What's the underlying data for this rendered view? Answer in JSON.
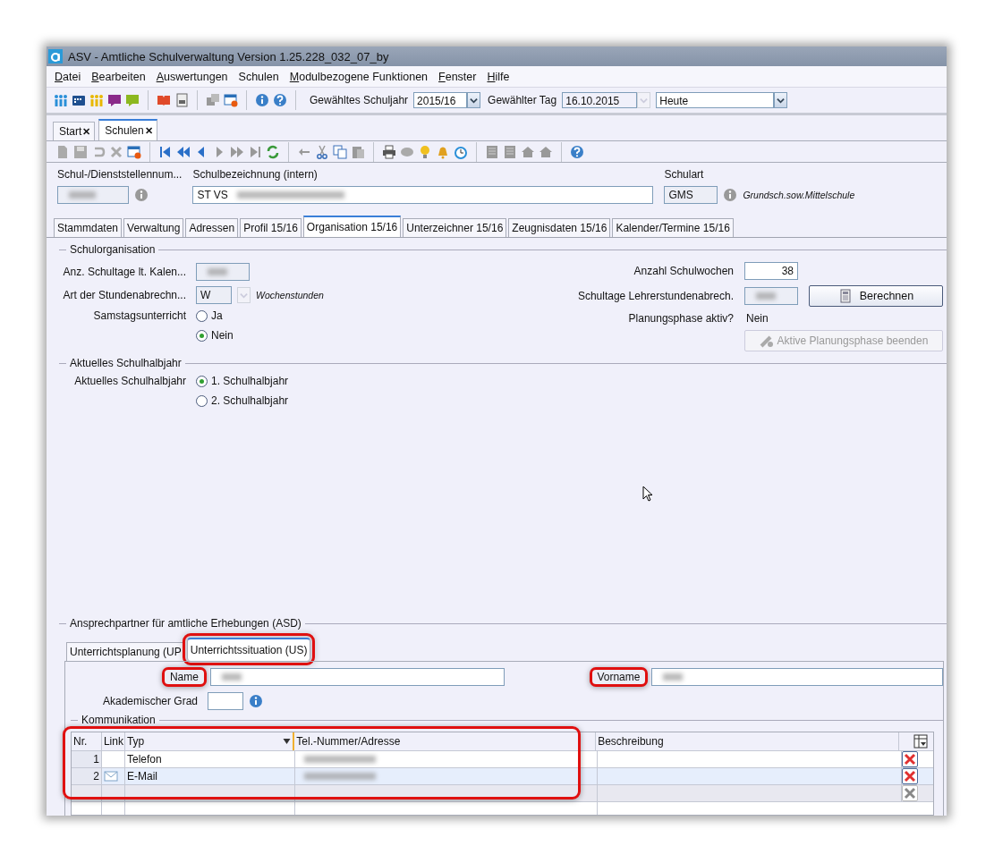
{
  "window": {
    "title": "ASV - Amtliche Schulverwaltung Version 1.25.228_032_07_by"
  },
  "menu": [
    {
      "label": "Datei",
      "mnemonic": true
    },
    {
      "label": "Bearbeiten",
      "mnemonic": true
    },
    {
      "label": "Auswertungen",
      "mnemonic": true
    },
    {
      "label": "Schulen",
      "mnemonic": false
    },
    {
      "label": "Modulbezogene Funktionen",
      "mnemonic": true
    },
    {
      "label": "Fenster",
      "mnemonic": true
    },
    {
      "label": "Hilfe",
      "mnemonic": true
    }
  ],
  "toolbar": {
    "schuljahr_label": "Gewähltes Schuljahr",
    "schuljahr": "2015/16",
    "tag_label": "Gewählter Tag",
    "tag": "16.10.2015",
    "tag_dropdown_disabled": true,
    "tag_mode": "Heute"
  },
  "document_tabs": [
    {
      "label": "Start",
      "close": "✕",
      "selected": false
    },
    {
      "label": "Schulen",
      "close": "✕",
      "selected": true
    }
  ],
  "header": {
    "nummer_label": "Schul-/Dienststellennum...",
    "bezeichnung_label": "Schulbezeichnung (intern)",
    "bezeichnung_value": "ST VS",
    "schulart_label": "Schulart",
    "schulart_value": "GMS",
    "schulart_text": "Grundsch.sow.Mittelschule"
  },
  "tabs": [
    {
      "label": "Stammdaten",
      "selected": false
    },
    {
      "label": "Verwaltung",
      "selected": false
    },
    {
      "label": "Adressen",
      "selected": false
    },
    {
      "label": "Profil 15/16",
      "selected": false
    },
    {
      "label": "Organisation 15/16",
      "selected": true
    },
    {
      "label": "Unterzeichner 15/16",
      "selected": false
    },
    {
      "label": "Zeugnisdaten 15/16",
      "selected": false
    },
    {
      "label": "Kalender/Termine 15/16",
      "selected": false
    }
  ],
  "schulorganisation": {
    "title": "Schulorganisation",
    "schultage_label": "Anz. Schultage lt. Kalen...",
    "stundenabrechnung_label": "Art der Stundenabrechn...",
    "stundenabrechnung_value": "W",
    "stundenabrechnung_text": "Wochenstunden",
    "samstag_label": "Samstagsunterricht",
    "samstag_options": [
      {
        "label": "Ja",
        "selected": false
      },
      {
        "label": "Nein",
        "selected": true
      }
    ],
    "schulwochen_label": "Anzahl  Schulwochen",
    "schulwochen_value": "38",
    "lehrerstunden_label": "Schultage Lehrerstundenabrech.",
    "berechnen_button": "Berechnen",
    "planungsphase_label": "Planungsphase aktiv?",
    "planungsphase_value": "Nein",
    "beenden_button": "Aktive Planungsphase beenden",
    "beenden_disabled": true
  },
  "schulhalbjahr": {
    "title": "Aktuelles Schulhalbjahr",
    "label": "Aktuelles Schulhalbjahr",
    "options": [
      {
        "label": "1. Schulhalbjahr",
        "selected": true
      },
      {
        "label": "2. Schulhalbjahr",
        "selected": false
      }
    ]
  },
  "ansprechpartner": {
    "title": "Ansprechpartner für amtliche Erhebungen (ASD)",
    "tabs": [
      {
        "label": "Unterrichtsplanung (UP",
        "selected": false,
        "highlighted": false
      },
      {
        "label": "Unterrichtssituation (US)",
        "selected": true,
        "highlighted": true
      }
    ],
    "name_label": "Name",
    "name_highlighted": true,
    "vorname_label": "Vorname",
    "vorname_highlighted": true,
    "grad_label": "Akademischer Grad",
    "kommunikation": {
      "title": "Kommunikation",
      "highlighted": true,
      "columns": [
        "Nr.",
        "Link",
        "Typ",
        "Tel.-Nummer/Adresse",
        "Beschreibung"
      ],
      "rows": [
        {
          "kind": "entry",
          "nr": "1",
          "link": false,
          "typ": "Telefon",
          "selected": false
        },
        {
          "kind": "entry",
          "nr": "2",
          "link": true,
          "typ": "E-Mail",
          "selected": true
        },
        {
          "kind": "empty"
        }
      ]
    }
  }
}
